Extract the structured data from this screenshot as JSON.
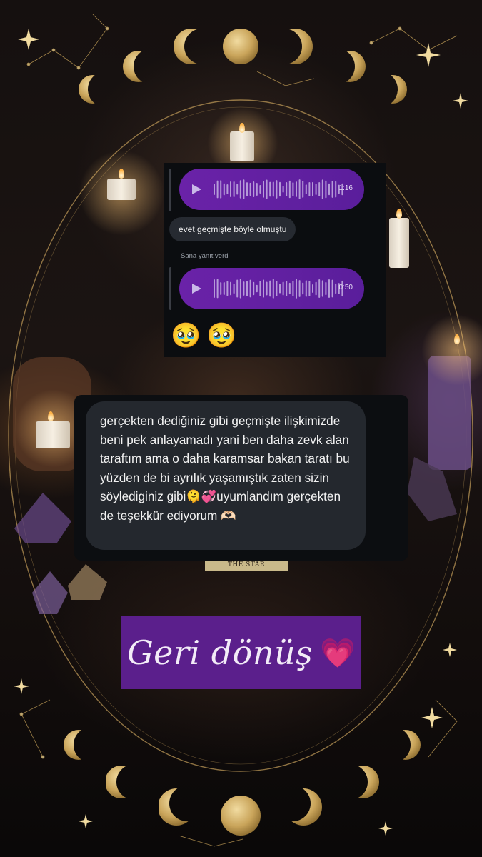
{
  "chat_screenshot": {
    "voice_messages": [
      {
        "duration": "1:16"
      },
      {
        "duration": "0:50"
      }
    ],
    "reply_text": "evet geçmişte böyle olmuştu",
    "reply_label": "Sana yanıt verdi",
    "reactions": [
      "🥹",
      "🥹"
    ]
  },
  "message": {
    "text": "gerçekten dediğiniz gibi geçmişte ilişkimizde beni pek anlayamadı yani ben daha zevk alan taraftım ama o daha karamsar bakan taratı bu yüzden de bi ayrılık yaşamıştık zaten sizin söylediginiz gibi🫠💞uyumlandım gerçekten de teşekkür ediyorum 🫶🏻"
  },
  "title": {
    "text": "Geri dönüş",
    "emoji": "💗"
  },
  "background": {
    "tarot_card_label": "THE STAR"
  },
  "colors": {
    "voice_bubble": "#6a22a8",
    "title_bg": "#5b1f8c",
    "moon_gold": "#d4b26a"
  }
}
